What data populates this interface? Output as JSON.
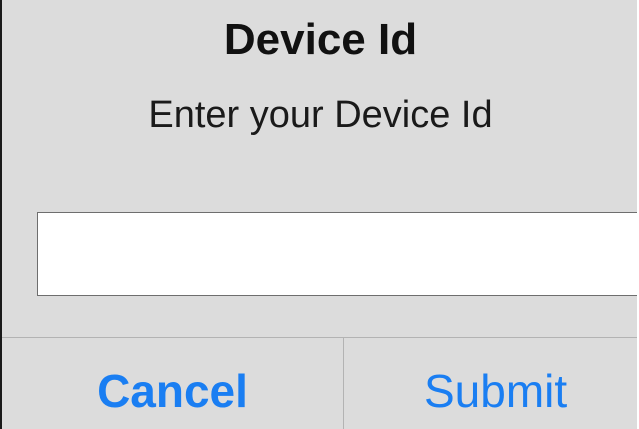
{
  "dialog": {
    "title": "Device Id",
    "message": "Enter your Device Id",
    "input": {
      "value": "",
      "placeholder": ""
    },
    "buttons": {
      "cancel_label": "Cancel",
      "submit_label": "Submit"
    }
  },
  "colors": {
    "dialog_background": "#dcdcdc",
    "button_text": "#1a7ef2",
    "input_background": "#ffffff",
    "divider": "#b3b3b3"
  }
}
